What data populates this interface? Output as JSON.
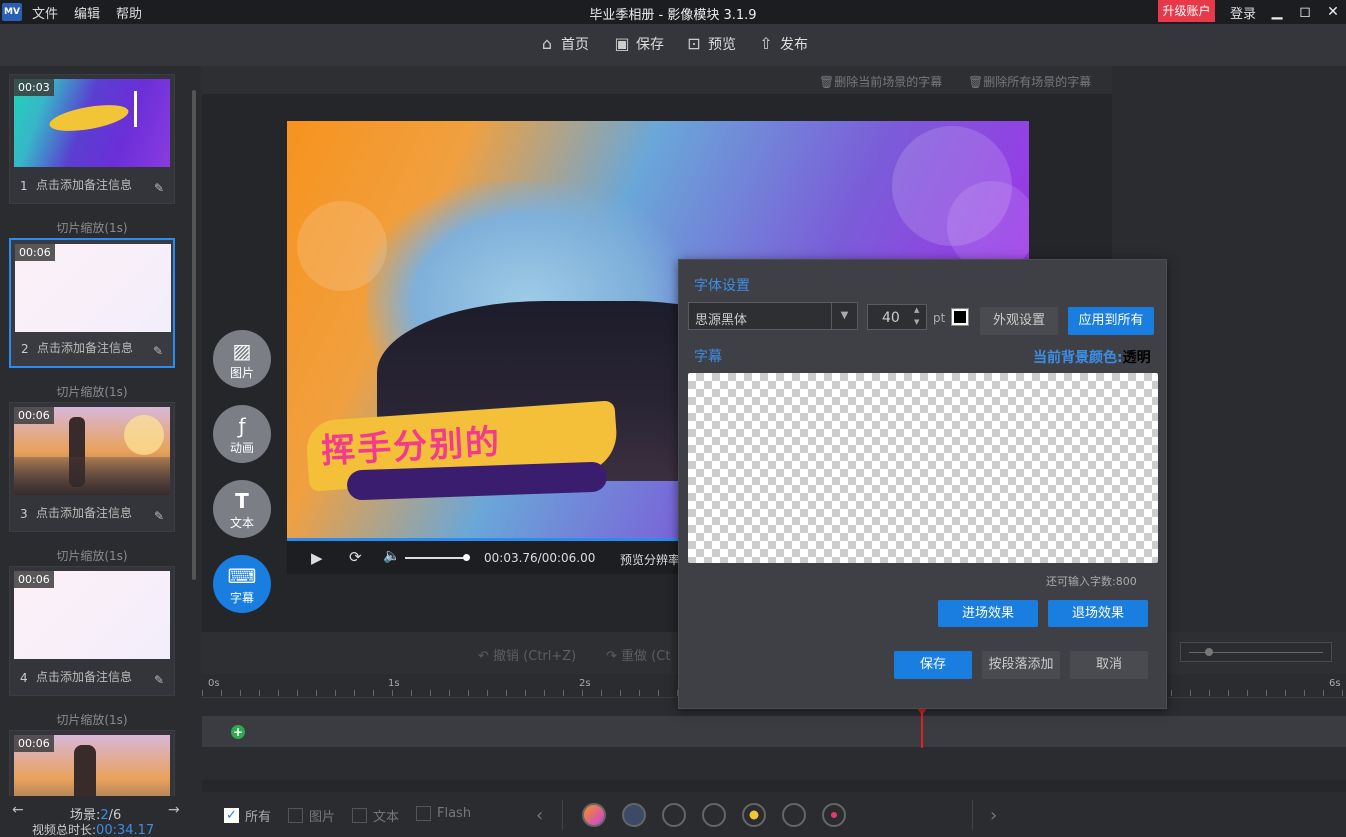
{
  "titlebar": {
    "logo": "MV",
    "menus": [
      "文件",
      "编辑",
      "帮助"
    ],
    "title": "毕业季相册 - 影像模块 3.1.9",
    "upgrade": "升级账户",
    "login": "登录"
  },
  "toolbar": {
    "home": "首页",
    "save": "保存",
    "preview": "预览",
    "publish": "发布"
  },
  "scenes": [
    {
      "duration": "00:03",
      "num": "1",
      "note": "点击添加备注信息",
      "transition": "切片缩放(1s)"
    },
    {
      "duration": "00:06",
      "num": "2",
      "note": "点击添加备注信息",
      "transition": "切片缩放(1s)"
    },
    {
      "duration": "00:06",
      "num": "3",
      "note": "点击添加备注信息",
      "transition": "切片缩放(1s)"
    },
    {
      "duration": "00:06",
      "num": "4",
      "note": "点击添加备注信息",
      "transition": "切片缩放(1s)"
    },
    {
      "duration": "00:06"
    }
  ],
  "left_bottom": {
    "scene_label": "场景:",
    "scene_current": "2",
    "scene_total": "/6",
    "total_label": "视频总时长:",
    "total_value": "00:34.17"
  },
  "caption_actions": {
    "delete_current": "删除当前场景的字幕",
    "delete_all": "删除所有场景的字幕"
  },
  "preview": {
    "headline": "挥手分别的",
    "time": "00:03.76/00:06.00",
    "resolution_label": "预览分辨率",
    "progress": 0.54
  },
  "tools": [
    {
      "label": "图片",
      "icon": "image-icon"
    },
    {
      "label": "动画",
      "icon": "animation-icon"
    },
    {
      "label": "文本",
      "icon": "text-icon"
    },
    {
      "label": "字幕",
      "icon": "subtitle-icon"
    }
  ],
  "undo": {
    "undo": "撤销 (Ctrl+Z)",
    "redo": "重做 (Ct"
  },
  "ruler": [
    "0s",
    "1s",
    "2s",
    "6s"
  ],
  "filters": [
    {
      "label": "所有",
      "checked": true
    },
    {
      "label": "图片",
      "checked": false
    },
    {
      "label": "文本",
      "checked": false
    },
    {
      "label": "Flash",
      "checked": false
    }
  ],
  "dialog": {
    "font_settings": "字体设置",
    "font_name": "思源黑体",
    "font_size": "40",
    "unit": "pt",
    "appearance": "外观设置",
    "apply_all": "应用到所有",
    "caption_label": "字幕",
    "bg_color_label": "当前背景颜色:",
    "bg_color_value": "透明",
    "remaining": "还可输入字数:",
    "remaining_value": "800",
    "enter_effect": "进场效果",
    "exit_effect": "退场效果",
    "save": "保存",
    "add_by_paragraph": "按段落添加",
    "cancel": "取消"
  },
  "colors": {
    "accent": "#1a7ee0",
    "upgrade": "#e8394a",
    "label_blue": "#3b8ee6"
  }
}
